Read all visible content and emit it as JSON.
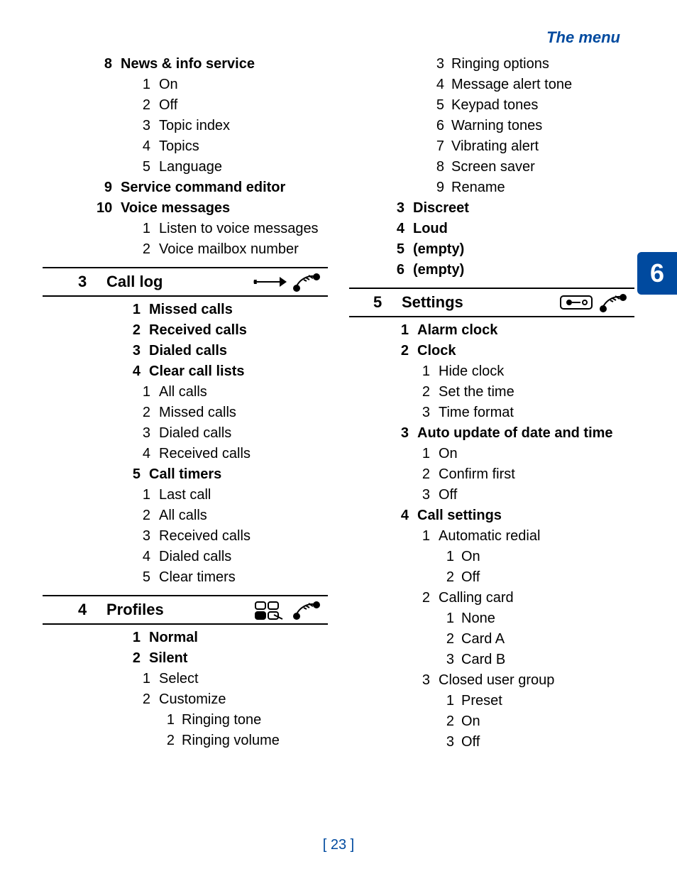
{
  "header": {
    "title": "The menu"
  },
  "tab_number": "6",
  "footer": {
    "page_number": "[ 23 ]"
  },
  "left": {
    "item8": {
      "num": "8",
      "label": "News & info service",
      "children": [
        {
          "num": "1",
          "label": "On"
        },
        {
          "num": "2",
          "label": "Off"
        },
        {
          "num": "3",
          "label": "Topic index"
        },
        {
          "num": "4",
          "label": "Topics"
        },
        {
          "num": "5",
          "label": "Language"
        }
      ]
    },
    "item9": {
      "num": "9",
      "label": "Service command editor"
    },
    "item10": {
      "num": "10",
      "label": "Voice messages",
      "children": [
        {
          "num": "1",
          "label": "Listen to voice messages"
        },
        {
          "num": "2",
          "label": "Voice mailbox number"
        }
      ]
    },
    "section3": {
      "num": "3",
      "label": "Call log",
      "children": [
        {
          "num": "1",
          "label": "Missed calls"
        },
        {
          "num": "2",
          "label": "Received calls"
        },
        {
          "num": "3",
          "label": "Dialed calls"
        },
        {
          "num": "4",
          "label": "Clear call lists",
          "children": [
            {
              "num": "1",
              "label": "All calls"
            },
            {
              "num": "2",
              "label": "Missed calls"
            },
            {
              "num": "3",
              "label": "Dialed calls"
            },
            {
              "num": "4",
              "label": "Received calls"
            }
          ]
        },
        {
          "num": "5",
          "label": "Call timers",
          "children": [
            {
              "num": "1",
              "label": "Last call"
            },
            {
              "num": "2",
              "label": "All calls"
            },
            {
              "num": "3",
              "label": "Received calls"
            },
            {
              "num": "4",
              "label": "Dialed calls"
            },
            {
              "num": "5",
              "label": "Clear timers"
            }
          ]
        }
      ]
    },
    "section4": {
      "num": "4",
      "label": "Profiles",
      "children": [
        {
          "num": "1",
          "label": "Normal"
        },
        {
          "num": "2",
          "label": "Silent",
          "children": [
            {
              "num": "1",
              "label": "Select"
            },
            {
              "num": "2",
              "label": "Customize",
              "children": [
                {
                  "num": "1",
                  "label": "Ringing tone"
                },
                {
                  "num": "2",
                  "label": "Ringing volume"
                }
              ]
            }
          ]
        }
      ]
    }
  },
  "right": {
    "continuation": [
      {
        "num": "3",
        "label": "Ringing options"
      },
      {
        "num": "4",
        "label": "Message alert tone"
      },
      {
        "num": "5",
        "label": "Keypad tones"
      },
      {
        "num": "6",
        "label": "Warning tones"
      },
      {
        "num": "7",
        "label": "Vibrating alert"
      },
      {
        "num": "8",
        "label": "Screen saver"
      },
      {
        "num": "9",
        "label": "Rename"
      }
    ],
    "profiles_tail": [
      {
        "num": "3",
        "label": "Discreet"
      },
      {
        "num": "4",
        "label": "Loud"
      },
      {
        "num": "5",
        "label": "(empty)"
      },
      {
        "num": "6",
        "label": "(empty)"
      }
    ],
    "section5": {
      "num": "5",
      "label": "Settings",
      "children": [
        {
          "num": "1",
          "label": "Alarm clock"
        },
        {
          "num": "2",
          "label": "Clock",
          "children": [
            {
              "num": "1",
              "label": "Hide clock"
            },
            {
              "num": "2",
              "label": "Set the time"
            },
            {
              "num": "3",
              "label": "Time format"
            }
          ]
        },
        {
          "num": "3",
          "label": "Auto update of date and time",
          "children": [
            {
              "num": "1",
              "label": "On"
            },
            {
              "num": "2",
              "label": "Confirm first"
            },
            {
              "num": "3",
              "label": "Off"
            }
          ]
        },
        {
          "num": "4",
          "label": "Call settings",
          "children": [
            {
              "num": "1",
              "label": "Automatic redial",
              "children": [
                {
                  "num": "1",
                  "label": "On"
                },
                {
                  "num": "2",
                  "label": "Off"
                }
              ]
            },
            {
              "num": "2",
              "label": "Calling card",
              "children": [
                {
                  "num": "1",
                  "label": "None"
                },
                {
                  "num": "2",
                  "label": "Card A"
                },
                {
                  "num": "3",
                  "label": "Card B"
                }
              ]
            },
            {
              "num": "3",
              "label": "Closed user group",
              "children": [
                {
                  "num": "1",
                  "label": "Preset"
                },
                {
                  "num": "2",
                  "label": "On"
                },
                {
                  "num": "3",
                  "label": "Off"
                }
              ]
            }
          ]
        }
      ]
    }
  }
}
